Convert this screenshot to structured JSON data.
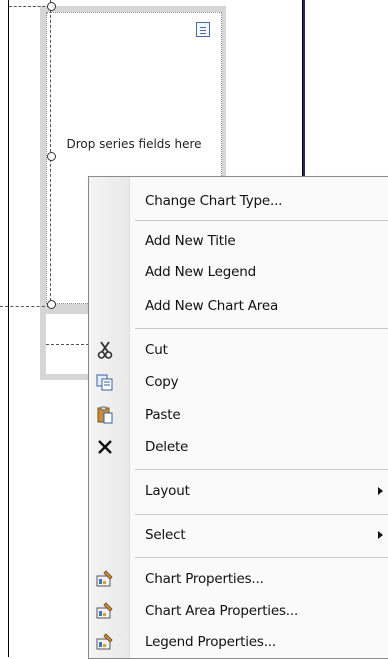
{
  "designer": {
    "drop_zone_text": "Drop series fields here"
  },
  "context_menu": {
    "items": [
      {
        "label": "Change Chart Type...",
        "icon": "none"
      },
      {
        "label": "Add New Title",
        "icon": "none"
      },
      {
        "label": "Add New Legend",
        "icon": "none"
      },
      {
        "label": "Add New Chart Area",
        "icon": "none"
      },
      {
        "label": "Cut",
        "icon": "scissors-icon"
      },
      {
        "label": "Copy",
        "icon": "copy-icon"
      },
      {
        "label": "Paste",
        "icon": "paste-icon"
      },
      {
        "label": "Delete",
        "icon": "delete-x-icon"
      },
      {
        "label": "Layout",
        "icon": "none",
        "submenu": true
      },
      {
        "label": "Select",
        "icon": "none",
        "submenu": true
      },
      {
        "label": "Chart Properties...",
        "icon": "properties-icon"
      },
      {
        "label": "Chart Area Properties...",
        "icon": "properties-icon"
      },
      {
        "label": "Legend Properties...",
        "icon": "properties-icon"
      }
    ]
  }
}
